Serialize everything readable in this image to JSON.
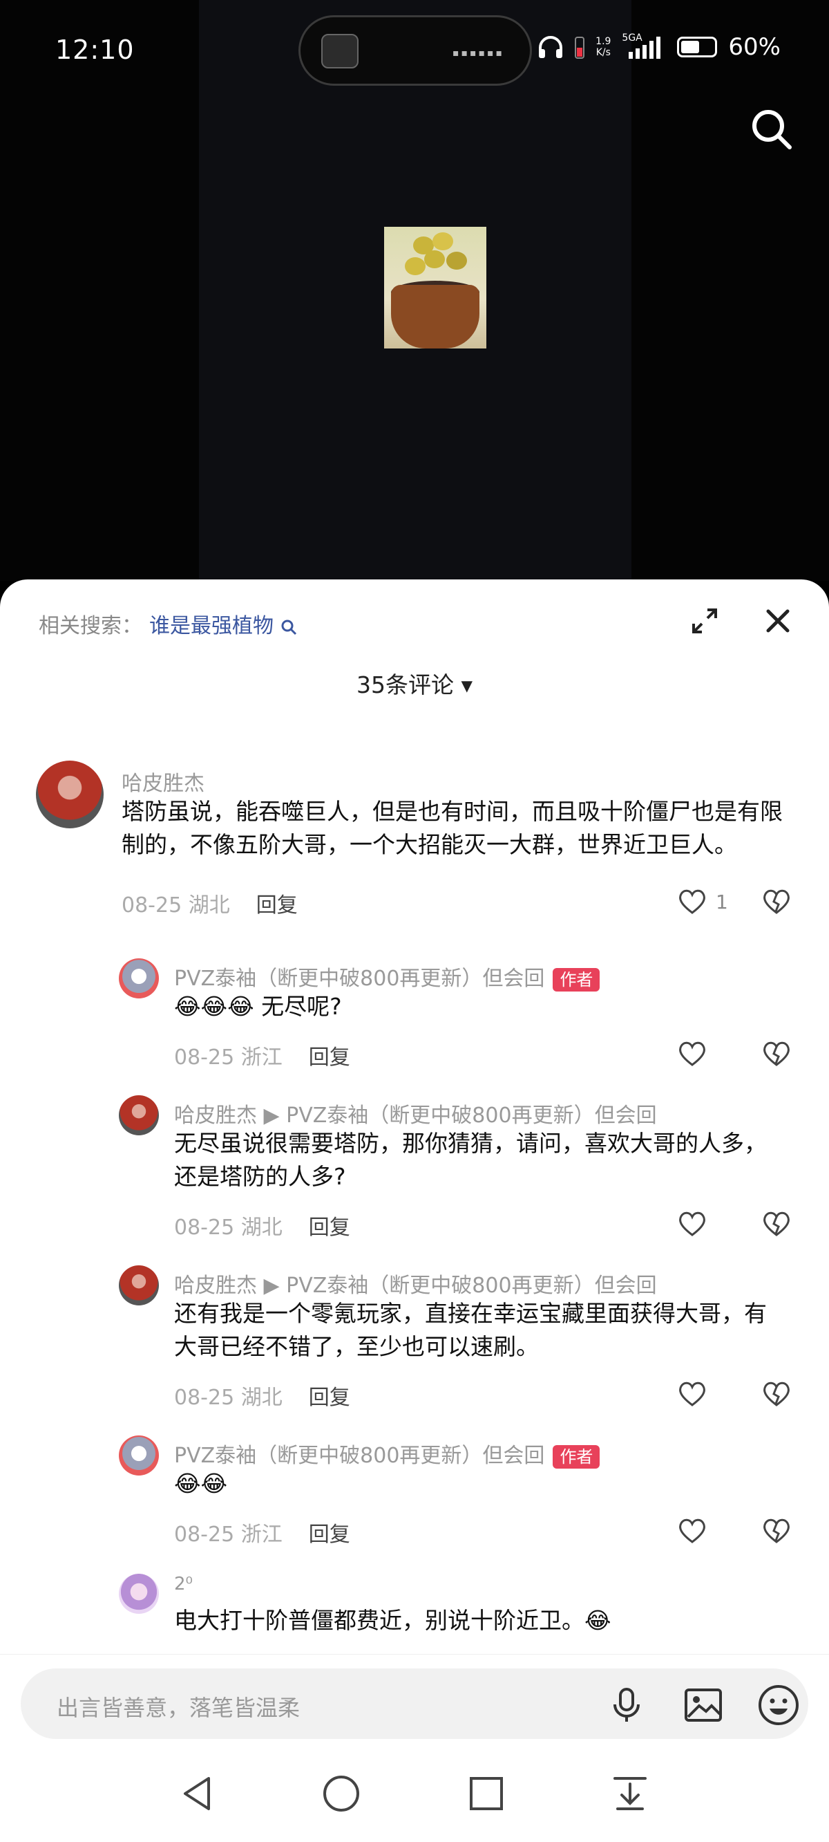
{
  "status_bar": {
    "time": "12:10",
    "network_speed": "1.9",
    "network_unit": "K/s",
    "network_type": "5GA",
    "battery": "60%"
  },
  "sheet": {
    "related_label": "相关搜索：",
    "related_keyword": "谁是最强植物",
    "comment_count": "35条评论"
  },
  "comments": [
    {
      "user": "哈皮胜杰",
      "text": "塔防虽说，能吞噬巨人，但是也有时间，而且吸十阶僵尸也是有限制的，不像五阶大哥，一个大招能灭一大群，世界近卫巨人。",
      "date": "08-25",
      "location": "湖北",
      "reply": "回复",
      "likes": "1"
    },
    {
      "user": "PVZ泰袖（断更中破800再更新）但会回",
      "tag": "作者",
      "text": "😂😂😂 无尽呢?",
      "date": "08-25",
      "location": "浙江",
      "reply": "回复"
    },
    {
      "user": "哈皮胜杰 ▶ PVZ泰袖（断更中破800再更新）但会回",
      "text": "无尽虽说很需要塔防，那你猜猜，请问，喜欢大哥的人多，还是塔防的人多?",
      "date": "08-25",
      "location": "湖北",
      "reply": "回复"
    },
    {
      "user": "哈皮胜杰 ▶ PVZ泰袖（断更中破800再更新）但会回",
      "text": "还有我是一个零氪玩家，直接在幸运宝藏里面获得大哥，有大哥已经不错了，至少也可以速刷。",
      "date": "08-25",
      "location": "湖北",
      "reply": "回复"
    },
    {
      "user": "PVZ泰袖（断更中破800再更新）但会回",
      "tag": "作者",
      "text": "😂😂",
      "date": "08-25",
      "location": "浙江",
      "reply": "回复"
    },
    {
      "user": "2⁰",
      "text": "电大打十阶普僵都费近，别说十阶近卫。😂"
    }
  ],
  "composer": {
    "placeholder": "出言皆善意，落笔皆温柔"
  }
}
